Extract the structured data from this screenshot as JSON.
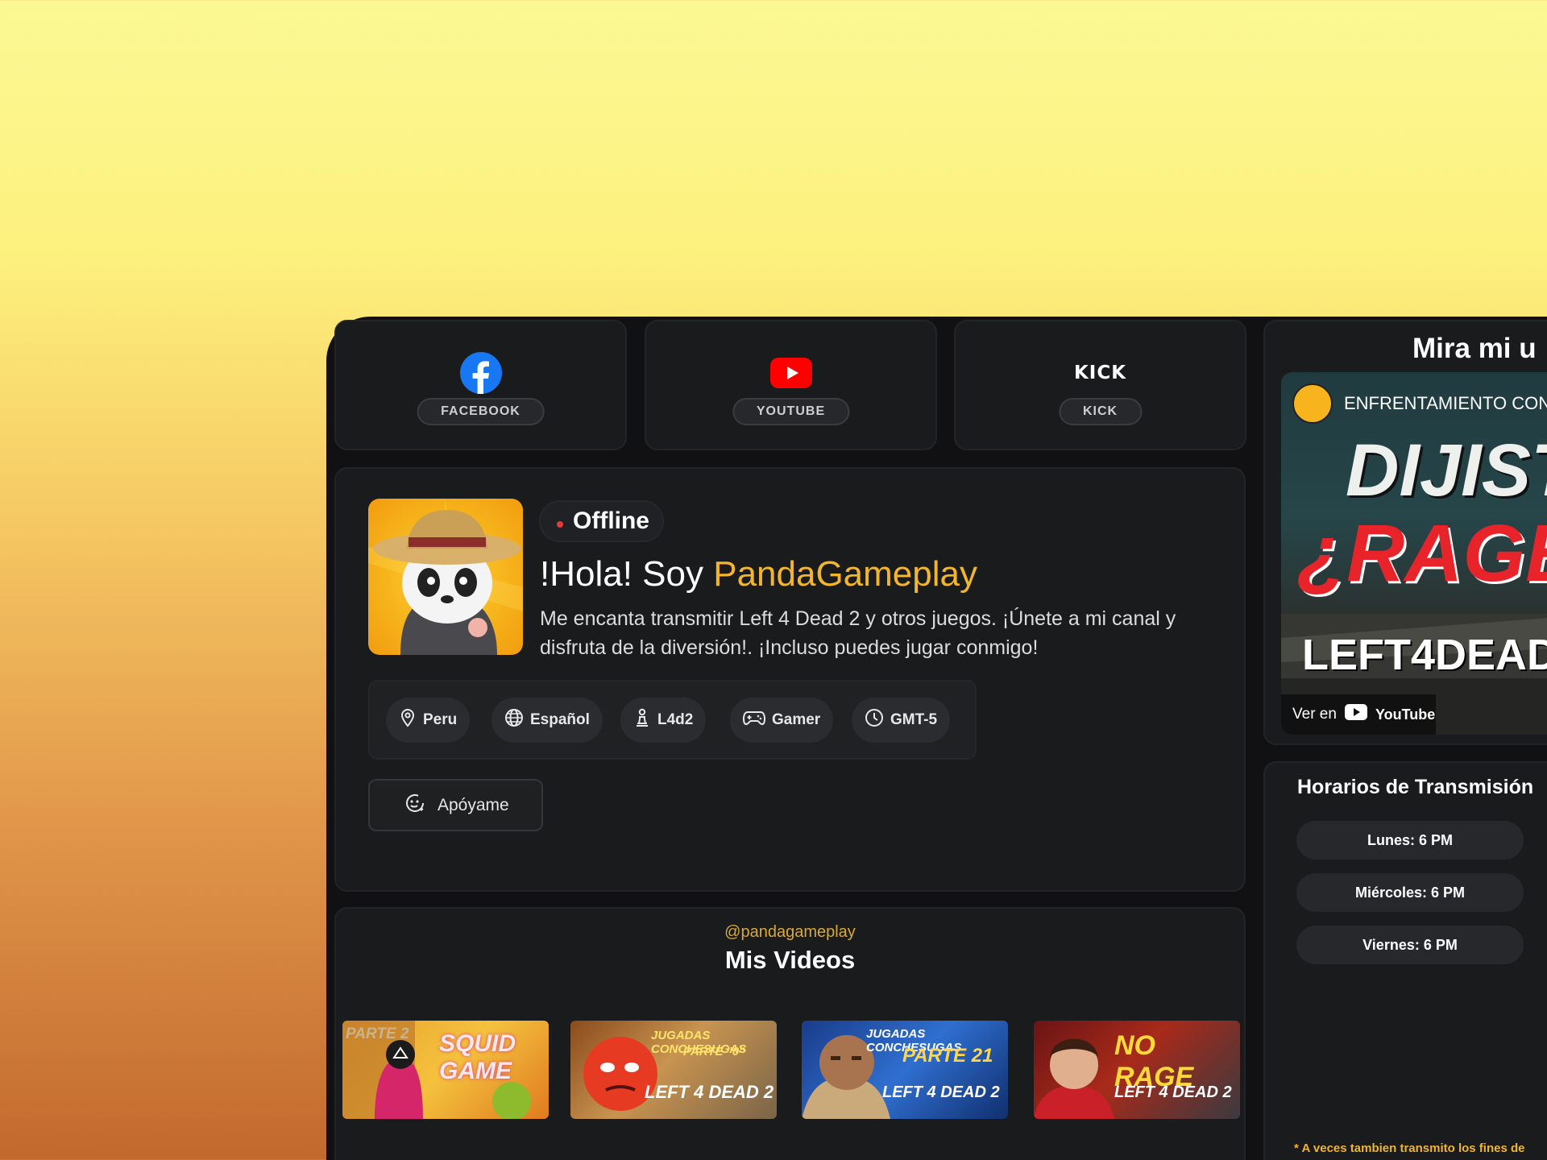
{
  "socials": [
    {
      "label": "FACEBOOK",
      "icon": "facebook-icon"
    },
    {
      "label": "YOUTUBE",
      "icon": "youtube-icon"
    },
    {
      "label": "KICK",
      "icon": "kick-logo",
      "logo_text": "KICK"
    }
  ],
  "profile": {
    "status": "Offline",
    "greeting": "!Hola! Soy",
    "name": "PandaGameplay",
    "bio": "Me encanta transmitir Left 4 Dead 2 y otros juegos. ¡Únete a mi canal y disfruta de la diversión!. ¡Incluso puedes jugar conmigo!",
    "tags": [
      {
        "label": "Peru",
        "icon": "location-pin-icon"
      },
      {
        "label": "Español",
        "icon": "globe-icon"
      },
      {
        "label": "L4d2",
        "icon": "chess-pawn-icon"
      },
      {
        "label": "Gamer",
        "icon": "gamepad-icon"
      },
      {
        "label": "GMT-5",
        "icon": "clock-icon"
      }
    ],
    "support_label": "Apóyame",
    "support_icon": "donate-face-icon"
  },
  "videos": {
    "handle": "@pandagameplay",
    "title": "Mis Videos",
    "thumbnails": [
      {
        "texts": [
          "PARTE 2",
          "SQUID GAME"
        ]
      },
      {
        "texts": [
          "JUGADAS CONCHESUGAS",
          "PARTE \"0\"",
          "LEFT 4 DEAD 2"
        ]
      },
      {
        "texts": [
          "JUGADAS CONCHESUGAS",
          "PARTE 21",
          "LEFT 4 DEAD 2"
        ]
      },
      {
        "texts": [
          "NO RAGE",
          "LEFT 4 DEAD 2"
        ]
      }
    ]
  },
  "player": {
    "title": "Mira mi u",
    "video_title": "ENFRENTAMIENTO CON",
    "thumb_big": "DIJIST",
    "thumb_rage": "¿RAGE",
    "thumb_game": "LEFT4DEAD",
    "watch_on": "Ver en",
    "youtube": "YouTube"
  },
  "schedule": {
    "title": "Horarios de Transmisión",
    "days": [
      "Lunes: 6 PM",
      "Miércoles: 6 PM",
      "Viernes: 6 PM"
    ],
    "note": "* A veces tambien transmito los fines de"
  },
  "colors": {
    "accent": "#f3b52c",
    "offline": "#e23b3b",
    "facebook": "#1877f2",
    "youtube": "#ff0000"
  }
}
